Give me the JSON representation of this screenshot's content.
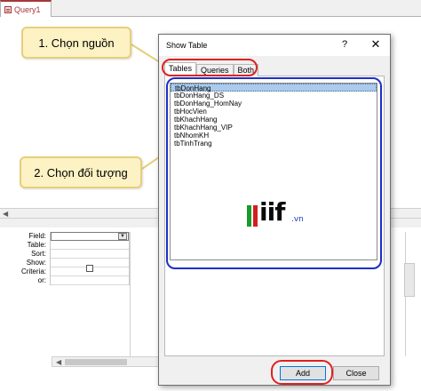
{
  "query_window": {
    "tab_label": "Query1",
    "grid_rows": [
      "Field:",
      "Table:",
      "Sort:",
      "Show:",
      "Criteria:",
      "or:"
    ]
  },
  "callouts": {
    "source": "1. Chọn nguồn",
    "object": "2. Chọn đối tượng"
  },
  "dialog": {
    "title": "Show Table",
    "help": "?",
    "close": "✕",
    "tabs": [
      "Tables",
      "Queries",
      "Both"
    ],
    "active_tab": "Tables",
    "tables": [
      "tbDonHang",
      "tbDonHang_DS",
      "tbDonHang_HomNay",
      "tbHocVien",
      "tbKhachHang",
      "tbKhachHang_VIP",
      "tbNhomKH",
      "tbTinhTrang"
    ],
    "selected_table": "tbDonHang",
    "add_label": "Add",
    "close_label": "Close"
  },
  "watermark": {
    "logo_text": "iif",
    "logo_suffix": ".vn"
  },
  "colors": {
    "callout_fill": "#fdf2c4",
    "highlight_red": "#e02020",
    "highlight_blue": "#1e2fc8",
    "selection": "#aacbec",
    "access_accent": "#a4373a"
  }
}
